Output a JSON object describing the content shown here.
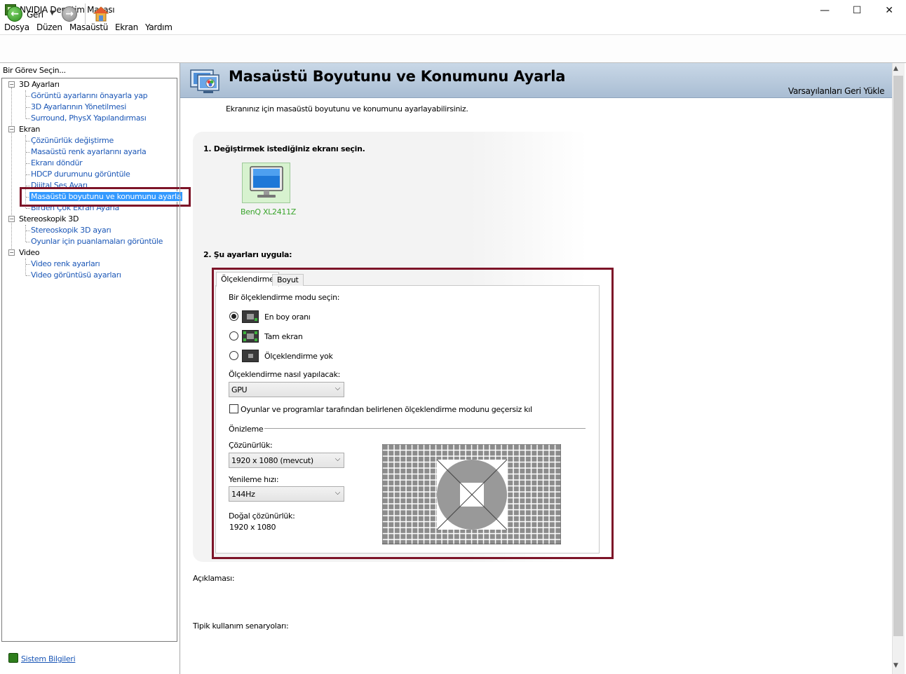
{
  "window": {
    "title": "NVIDIA Denetim Masası",
    "minimize": "—",
    "maximize": "☐",
    "close": "✕"
  },
  "menu": [
    "Dosya",
    "Düzen",
    "Masaüstü",
    "Ekran",
    "Yardım"
  ],
  "toolbar": {
    "back_label": "Geri",
    "dropdown_glyph": "▼",
    "back_glyph": "←",
    "forward_glyph": "→"
  },
  "task_panel": {
    "header": "Bir Görev Seçin...",
    "groups": [
      {
        "label": "3D Ayarları",
        "items": [
          "Görüntü ayarlarını önayarla yap",
          "3D Ayarlarının Yönetilmesi",
          "Surround, PhysX Yapılandırması"
        ]
      },
      {
        "label": "Ekran",
        "items": [
          "Çözünürlük değiştirme",
          "Masaüstü renk ayarlarını ayarla",
          "Ekranı döndür",
          "HDCP durumunu görüntüle",
          "Dijital Ses Ayarı",
          "Masaüstü boyutunu ve konumunu ayarla",
          "Birden Çok Ekran Ayarla"
        ]
      },
      {
        "label": "Stereoskopik 3D",
        "items": [
          "Stereoskopik 3D ayarı",
          "Oyunlar için puanlamaları görüntüle"
        ]
      },
      {
        "label": "Video",
        "items": [
          "Video renk ayarları",
          "Video görüntüsü ayarları"
        ]
      }
    ],
    "toggle_glyph": "−",
    "selected_item": "Masaüstü boyutunu ve konumunu ayarla",
    "system_info": "Sistem Bilgileri"
  },
  "page": {
    "title": "Masaüstü Boyutunu ve Konumunu Ayarla",
    "restore_defaults": "Varsayılanları Geri Yükle",
    "intro": "Ekranınız için masaüstü boyutunu ve konumunu ayarlayabilirsiniz.",
    "step1": "1. Değiştirmek istediğiniz ekranı seçin.",
    "monitor_name": "BenQ XL2411Z",
    "step2": "2. Şu ayarları uygula:",
    "tabs": [
      "Ölçeklendirme",
      "Boyut"
    ],
    "scaling_mode_label": "Bir ölçeklendirme modu seçin:",
    "modes": [
      {
        "label": "En boy oranı",
        "selected": true
      },
      {
        "label": "Tam ekran",
        "selected": false
      },
      {
        "label": "Ölçeklendirme yok",
        "selected": false
      }
    ],
    "perform_label": "Ölçeklendirme nasıl yapılacak:",
    "perform_value": "GPU",
    "override_label": "Oyunlar ve programlar tarafından belirlenen ölçeklendirme modunu geçersiz kıl",
    "override_checked": false,
    "preview_label": "Önizleme",
    "resolution_label": "Çözünürlük:",
    "resolution_value": "1920 x 1080 (mevcut)",
    "refresh_label": "Yenileme hızı:",
    "refresh_value": "144Hz",
    "native_label": "Doğal çözünürlük:",
    "native_value": "1920 x 1080",
    "description_label": "Açıklaması:",
    "usage_label": "Tipik kullanım senaryoları:",
    "chevron": "⌵"
  },
  "colors": {
    "accent_red": "#7d1428",
    "link_blue": "#1a56b6",
    "nvidia_green": "#3aa52c",
    "header_blue": "#b9cadd"
  }
}
